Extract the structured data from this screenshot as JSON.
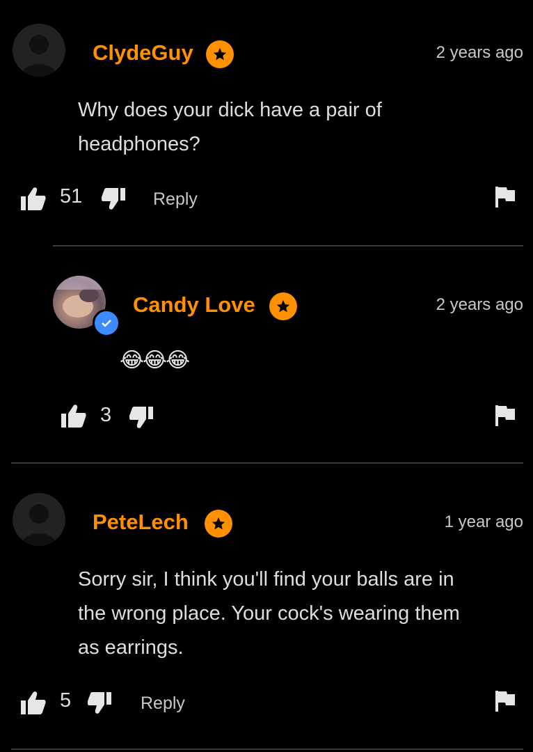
{
  "comments": [
    {
      "username": "ClydeGuy",
      "time": "2 years ago",
      "lines": [
        "Why does your dick have a pair of",
        "headphones?"
      ],
      "likes": "51",
      "reply_label": "Reply"
    },
    {
      "username": "Candy Love",
      "time": "2 years ago",
      "emoji": "😂😂😂",
      "likes": "3"
    },
    {
      "username": "PeteLech",
      "time": "1 year ago",
      "lines": [
        "Sorry sir, I think you'll find your balls are in",
        "the wrong place. Your cock's wearing them",
        "as earrings."
      ],
      "likes": "5",
      "reply_label": "Reply"
    }
  ],
  "colors": {
    "accent": "#ff9000",
    "verified": "#3d8bff",
    "background": "#000000"
  }
}
